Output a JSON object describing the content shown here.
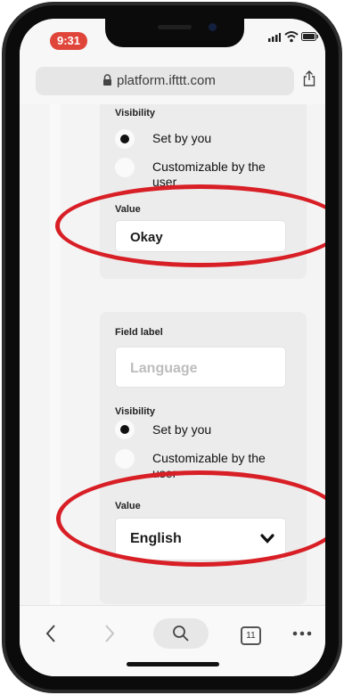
{
  "status_bar": {
    "time": "9:31"
  },
  "browser": {
    "url": "platform.ifttt.com",
    "tab_count": "11"
  },
  "field_1": {
    "visibility_label": "Visibility",
    "option_set_by_you": "Set by you",
    "option_customizable_line1": "Customizable by the",
    "option_customizable_line2": "user",
    "selected": "Set by you",
    "value_label": "Value",
    "value": "Okay"
  },
  "field_2": {
    "field_label_heading": "Field label",
    "field_label_placeholder": "Language",
    "visibility_label": "Visibility",
    "option_set_by_you": "Set by you",
    "option_customizable_line1": "Customizable by the",
    "option_customizable_line2": "user",
    "selected": "Set by you",
    "value_label": "Value",
    "value_selected": "English"
  },
  "icons": {
    "lock": "lock-icon",
    "share": "share-icon",
    "back": "chevron-left-icon",
    "forward": "chevron-right-icon",
    "search": "search-icon",
    "tabs": "tabs-icon",
    "more": "more-icon",
    "dropdown": "chevron-down-icon"
  },
  "colors": {
    "annotation": "#d81f26",
    "time_pill": "#e0453a"
  }
}
